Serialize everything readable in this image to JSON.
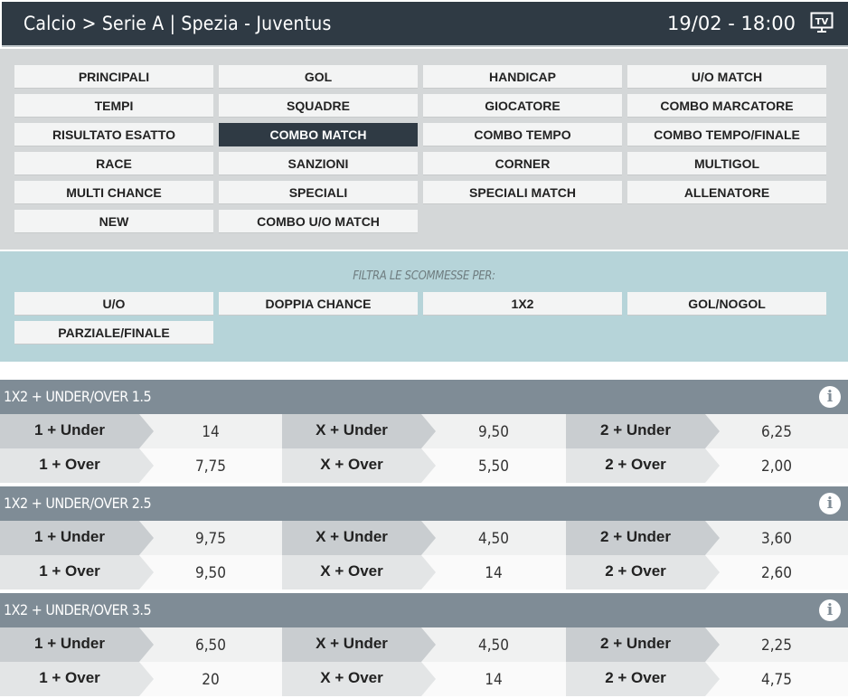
{
  "header": {
    "title": "Calcio > Serie A | Spezia - Juventus",
    "datetime": "19/02 - 18:00",
    "tv_icon": "tv-icon"
  },
  "markets": [
    "PRINCIPALI",
    "GOL",
    "HANDICAP",
    "U/O MATCH",
    "TEMPI",
    "SQUADRE",
    "GIOCATORE",
    "COMBO MARCATORE",
    "RISULTATO ESATTO",
    "COMBO MATCH",
    "COMBO TEMPO",
    "COMBO TEMPO/FINALE",
    "RACE",
    "SANZIONI",
    "CORNER",
    "MULTIGOL",
    "MULTI CHANCE",
    "SPECIALI",
    "SPECIALI MATCH",
    "ALLENATORE",
    "NEW",
    "COMBO U/O MATCH"
  ],
  "active_market": "COMBO MATCH",
  "filters": {
    "caption": "FILTRA LE SCOMMESSE PER:",
    "items": [
      "U/O",
      "DOPPIA CHANCE",
      "1X2",
      "GOL/NOGOL",
      "PARZIALE/FINALE"
    ]
  },
  "sections": [
    {
      "title": "1X2 + UNDER/OVER 1.5",
      "rows": [
        [
          {
            "label": "1 + Under",
            "odd": "14"
          },
          {
            "label": "X + Under",
            "odd": "9,50"
          },
          {
            "label": "2 + Under",
            "odd": "6,25"
          }
        ],
        [
          {
            "label": "1 + Over",
            "odd": "7,75"
          },
          {
            "label": "X + Over",
            "odd": "5,50"
          },
          {
            "label": "2 + Over",
            "odd": "2,00"
          }
        ]
      ]
    },
    {
      "title": "1X2 + UNDER/OVER 2.5",
      "rows": [
        [
          {
            "label": "1 + Under",
            "odd": "9,75"
          },
          {
            "label": "X + Under",
            "odd": "4,50"
          },
          {
            "label": "2 + Under",
            "odd": "3,60"
          }
        ],
        [
          {
            "label": "1 + Over",
            "odd": "9,50"
          },
          {
            "label": "X + Over",
            "odd": "14"
          },
          {
            "label": "2 + Over",
            "odd": "2,60"
          }
        ]
      ]
    },
    {
      "title": "1X2 + UNDER/OVER 3.5",
      "rows": [
        [
          {
            "label": "1 + Under",
            "odd": "6,50"
          },
          {
            "label": "X + Under",
            "odd": "4,50"
          },
          {
            "label": "2 + Under",
            "odd": "2,25"
          }
        ],
        [
          {
            "label": "1 + Over",
            "odd": "20"
          },
          {
            "label": "X + Over",
            "odd": "14"
          },
          {
            "label": "2 + Over",
            "odd": "4,75"
          }
        ]
      ]
    }
  ],
  "info_icon": "info-icon",
  "info_glyph": "i"
}
